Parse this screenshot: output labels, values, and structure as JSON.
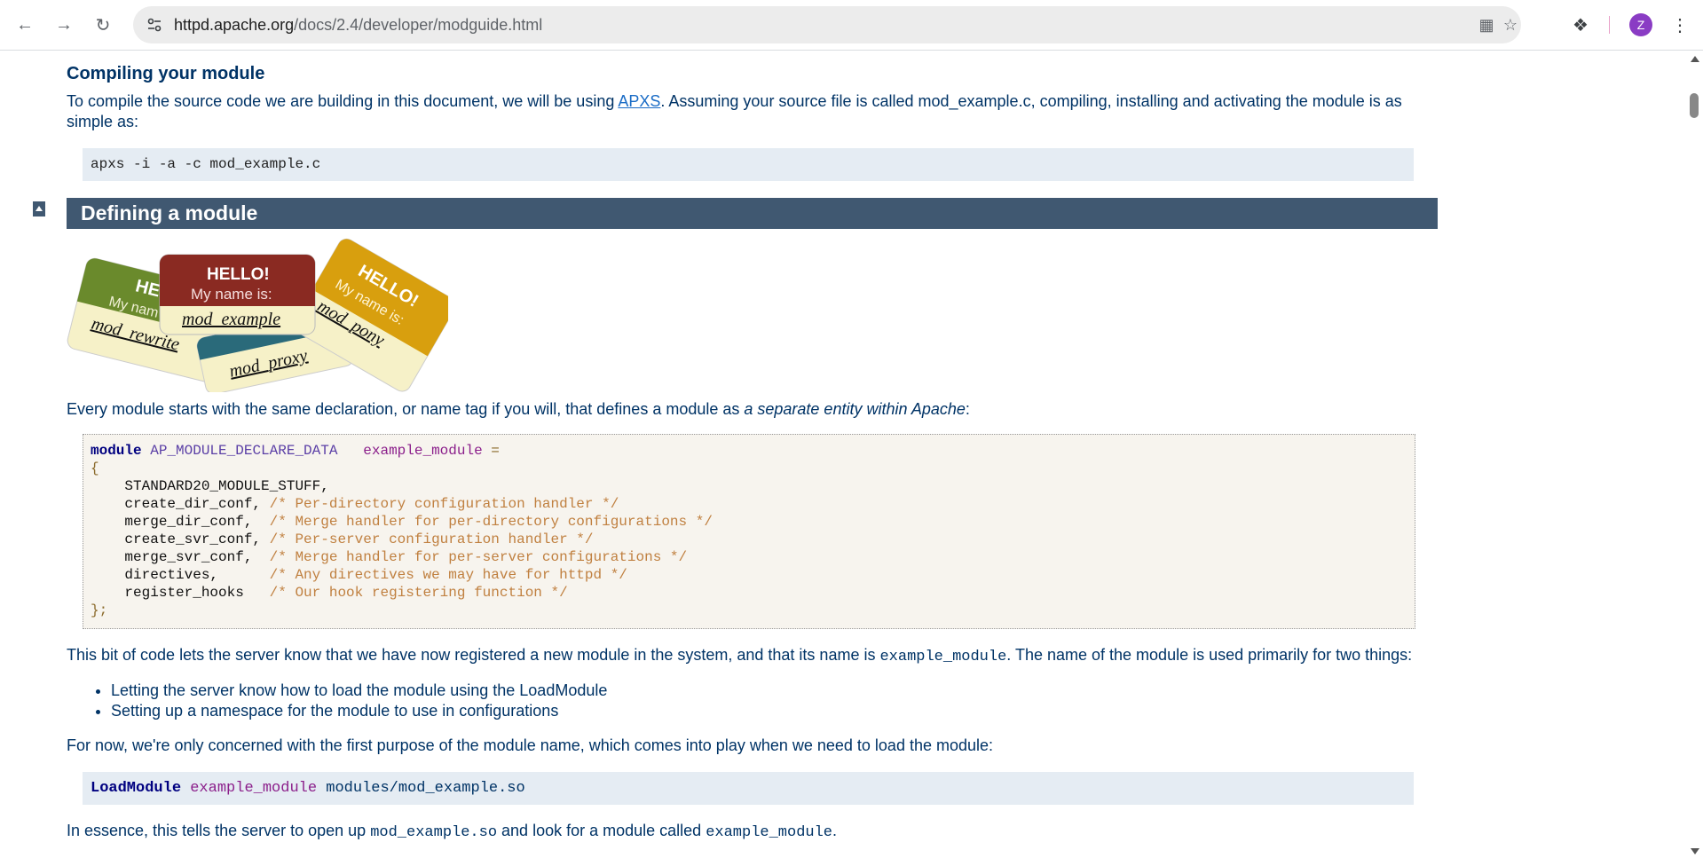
{
  "browser": {
    "url_host": "httpd.apache.org",
    "url_path": "/docs/2.4/developer/modguide.html",
    "avatar_letter": "Z"
  },
  "compile": {
    "heading": "Compiling your module",
    "text_before": "To compile the source code we are building in this document, we will be using ",
    "link": "APXS",
    "text_after": ". Assuming your source file is called mod_example.c, compiling, installing and activating the module is as simple as:",
    "command": "apxs -i -a -c mod_example.c"
  },
  "section": {
    "title": "Defining a module"
  },
  "nametags": {
    "hello": "HELLO!",
    "my_name_is": "My name is:",
    "hel_partial": "HEL",
    "my_nam_partial": "My nam",
    "tag1": "mod_rewrite",
    "tag2": "mod_example",
    "tag3": "mod_proxy",
    "tag4": "mod_pony"
  },
  "every": {
    "text": "Every module starts with the same declaration, or name tag if you will, that defines a module as ",
    "em": "a separate entity within Apache",
    "end": ":"
  },
  "module_code": {
    "kw": "module",
    "type": "AP_MODULE_DECLARE_DATA",
    "var": "example_module",
    "eq": "=",
    "open": "{",
    "close": "};",
    "lines": [
      {
        "name": "    STANDARD20_MODULE_STUFF,",
        "comment": ""
      },
      {
        "name": "    create_dir_conf, ",
        "comment": "/* Per-directory configuration handler */"
      },
      {
        "name": "    merge_dir_conf,  ",
        "comment": "/* Merge handler for per-directory configurations */"
      },
      {
        "name": "    create_svr_conf, ",
        "comment": "/* Per-server configuration handler */"
      },
      {
        "name": "    merge_svr_conf,  ",
        "comment": "/* Merge handler for per-server configurations */"
      },
      {
        "name": "    directives,      ",
        "comment": "/* Any directives we may have for httpd */"
      },
      {
        "name": "    register_hooks   ",
        "comment": "/* Our hook registering function */"
      }
    ]
  },
  "bit": {
    "before": "This bit of code lets the server know that we have now registered a new module in the system, and that its name is ",
    "code": "example_module",
    "after": ". The name of the module is used primarily for two things:"
  },
  "list": [
    "Letting the server know how to load the module using the LoadModule",
    "Setting up a namespace for the module to use in configurations"
  ],
  "now": {
    "text": "For now, we're only concerned with the first purpose of the module name, which comes into play when we need to load the module:"
  },
  "loadmodule": {
    "kw": "LoadModule",
    "var": "example_module",
    "path": "modules/mod_example.so"
  },
  "essence": {
    "t1": "In essence, this tells the server to open up ",
    "c1": "mod_example.so",
    "t2": " and look for a module called ",
    "c2": "example_module",
    "t3": "."
  }
}
